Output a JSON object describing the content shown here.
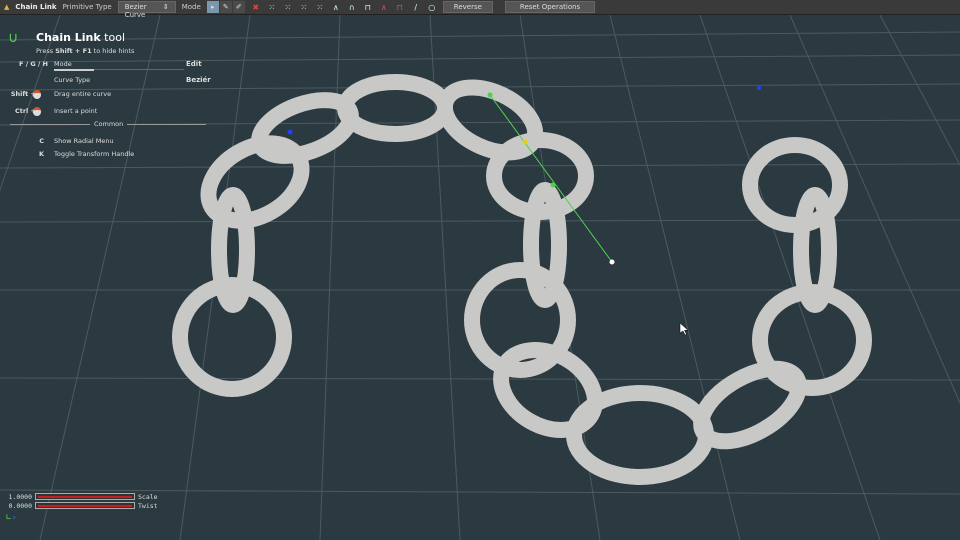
{
  "toolbar": {
    "title": "Chain Link",
    "primitive_type_label": "Primitive Type",
    "primitive_type_value": "Bezier Curve",
    "mode_label": "Mode",
    "reverse": "Reverse",
    "reset": "Reset Operations"
  },
  "hints": {
    "title_bold": "Chain Link",
    "title_rest": " tool",
    "sub_pre": "Press ",
    "sub_key": "Shift + F1",
    "sub_post": " to hide hints",
    "mode_keys": "F / G / H",
    "mode_label": "Mode",
    "mode_value": "Edit",
    "curve_type_label": "Curve Type",
    "curve_type_value": "Beziér",
    "shift_key": "Shift +",
    "shift_desc": "Drag entire curve",
    "ctrl_key": "Ctrl +",
    "ctrl_desc": "Insert a point",
    "common": "Common",
    "c_key": "C",
    "c_desc": "Show Radial Menu",
    "k_key": "K",
    "k_desc": "Toggle Transform Handle"
  },
  "sliders": [
    {
      "label": "Scale",
      "value": "1.0000",
      "fraction": 1.0
    },
    {
      "label": "Twist",
      "value": "0.0000",
      "fraction": 0.0
    }
  ],
  "colors": {
    "link": "#c8c8c6",
    "curve": "#4fd04f",
    "accent": "#c42020"
  }
}
